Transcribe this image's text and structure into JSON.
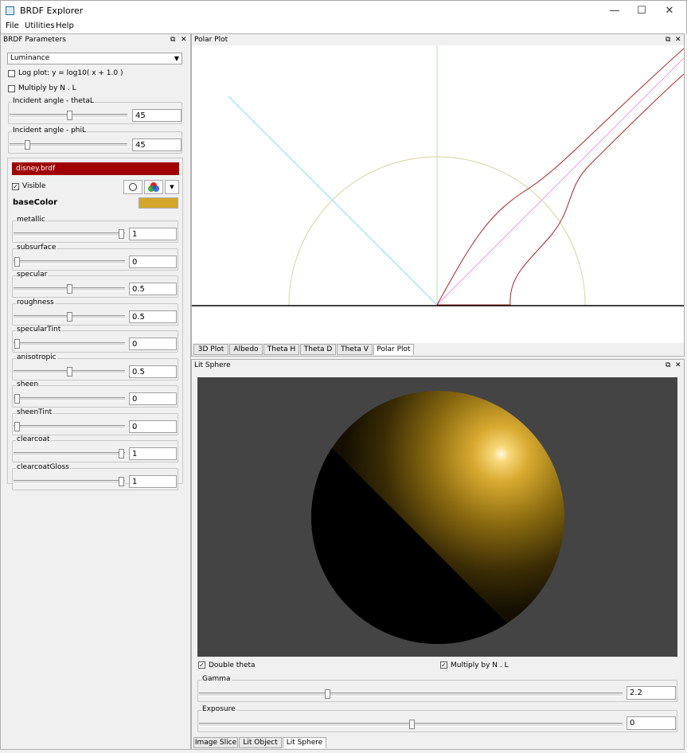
{
  "window": {
    "title": "BRDF Explorer",
    "minimize": "—",
    "maximize": "☐",
    "close": "✕"
  },
  "menu": [
    "File",
    "Utilities",
    "Help"
  ],
  "brdf_params": {
    "header": "BRDF Parameters",
    "mode": "Luminance",
    "log_plot_label": "Log plot:  y = log10( x + 1.0 )",
    "multiply_label": "Multiply by N . L",
    "theta_label": "Incident angle - thetaL",
    "theta_value": "45",
    "phi_label": "Incident angle - phiL",
    "phi_value": "45",
    "brdf_name": "disney.brdf",
    "visible_label": "Visible",
    "basecolor_label": "baseColor",
    "basecolor_hex": "#d4a72c",
    "params": [
      {
        "name": "metallic",
        "value": "1",
        "level": 1.0
      },
      {
        "name": "subsurface",
        "value": "0",
        "level": 0.0
      },
      {
        "name": "specular",
        "value": "0.5",
        "level": 0.5
      },
      {
        "name": "roughness",
        "value": "0.5",
        "level": 0.5
      },
      {
        "name": "specularTint",
        "value": "0",
        "level": 0.0
      },
      {
        "name": "anisotropic",
        "value": "0.5",
        "level": 0.5
      },
      {
        "name": "sheen",
        "value": "0",
        "level": 0.0
      },
      {
        "name": "sheenTint",
        "value": "0",
        "level": 0.0
      },
      {
        "name": "clearcoat",
        "value": "1",
        "level": 1.0
      },
      {
        "name": "clearcoatGloss",
        "value": "1",
        "level": 1.0
      }
    ]
  },
  "polar_plot": {
    "header": "Polar Plot",
    "tabs": [
      "3D Plot",
      "Albedo",
      "Theta H",
      "Theta D",
      "Theta V",
      "Polar Plot"
    ],
    "active_tab": "Polar Plot"
  },
  "lit_sphere": {
    "header": "Lit Sphere",
    "double_theta_label": "Double theta",
    "multiply_label": "Multiply by N . L",
    "gamma_label": "Gamma",
    "gamma_value": "2.2",
    "exposure_label": "Exposure",
    "exposure_value": "0",
    "tabs": [
      "Image Slice",
      "Lit Object",
      "Lit Sphere"
    ],
    "active_tab": "Lit Sphere"
  },
  "colors": {
    "brdf_bar": "#a00000",
    "plot_curve": "#b22222",
    "light_dir": "#7fe0ff"
  }
}
